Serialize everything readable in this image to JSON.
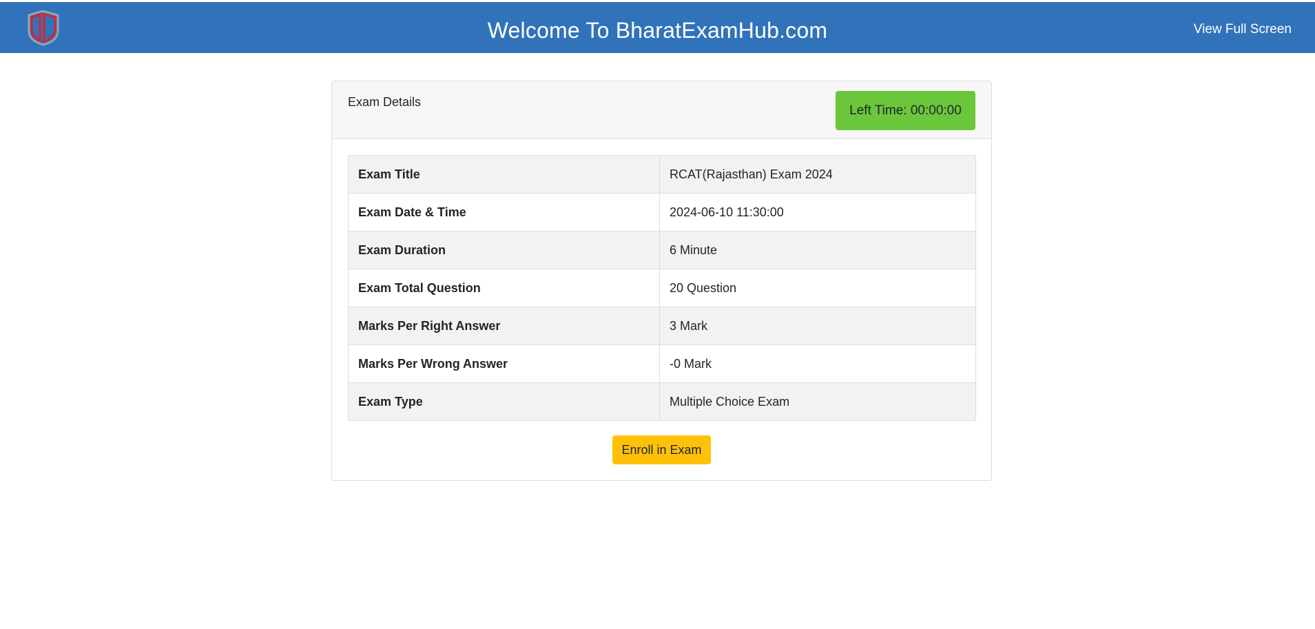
{
  "header": {
    "logo_icon": "shield-logo-icon",
    "title": "Welcome To BharatExamHub.com",
    "fullscreen_label": "View Full Screen",
    "colors": {
      "background": "#3173ba",
      "text": "#ffffff"
    }
  },
  "card": {
    "title": "Exam Details",
    "timer": {
      "label": "Left Time: 00:00:00",
      "color": "#6cc63c"
    },
    "details": [
      {
        "label": "Exam Title",
        "value": "RCAT(Rajasthan) Exam 2024"
      },
      {
        "label": "Exam Date & Time",
        "value": "2024-06-10 11:30:00"
      },
      {
        "label": "Exam Duration",
        "value": "6 Minute"
      },
      {
        "label": "Exam Total Question",
        "value": "20 Question"
      },
      {
        "label": "Marks Per Right Answer",
        "value": "3 Mark"
      },
      {
        "label": "Marks Per Wrong Answer",
        "value": "-0 Mark"
      },
      {
        "label": "Exam Type",
        "value": "Multiple Choice Exam"
      }
    ],
    "enroll_label": "Enroll in Exam",
    "enroll_color": "#ffc107"
  }
}
